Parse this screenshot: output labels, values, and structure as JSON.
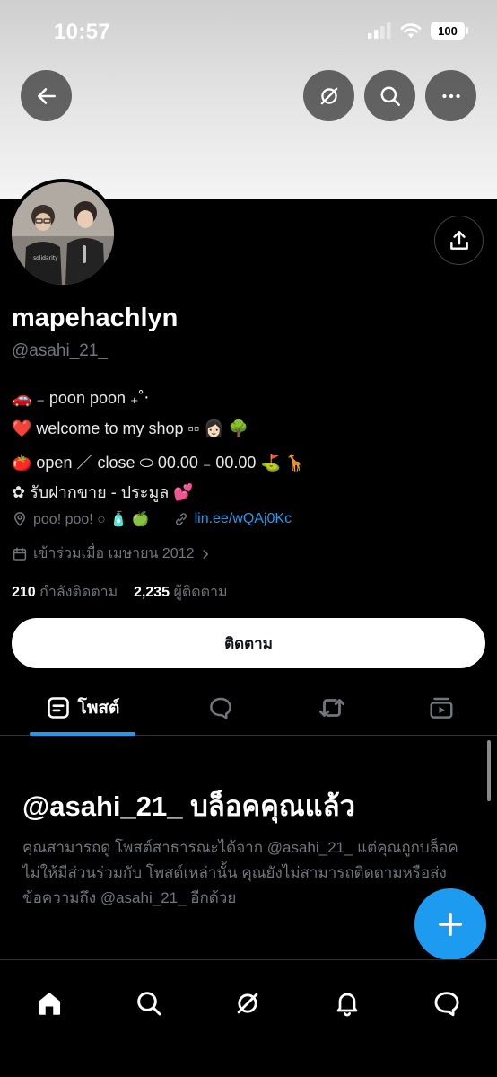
{
  "status_bar": {
    "time": "10:57",
    "battery": "100"
  },
  "profile": {
    "display_name": "mapehachlyn",
    "handle": "@asahi_21_",
    "bio": [
      "🚗 ₋ poon poon ₊˚‧",
      "❤️ welcome to my shop ▫▫ 👩🏻 🌳",
      "🍅 open ／ close ⬭ 00.00 ₋ 00.00 ⛳ 🦒",
      "✿ รับฝากขาย - ประมูล 💕"
    ],
    "location": "poo! poo! ○ 🧴 🍏",
    "link": "lin.ee/wQAj0Kc",
    "joined": "เข้าร่วมเมื่อ เมษายน 2012",
    "following_count": "210",
    "following_label": "กำลังติดตาม",
    "followers_count": "2,235",
    "followers_label": "ผู้ติดตาม"
  },
  "follow_button": "ติดตาม",
  "tabs": {
    "posts_label": "โพสต์"
  },
  "blocked": {
    "title": "@asahi_21_ บล็อคคุณแล้ว",
    "description": "คุณสามารถดู โพสต์สาธารณะได้จาก @asahi_21_ แต่คุณถูกบล็อคไม่ให้มีส่วนร่วมกับ โพสต์เหล่านั้น คุณยังไม่สามารถติดตามหรือส่งข้อความถึง @asahi_21_ อีกด้วย"
  },
  "colors": {
    "accent": "#1d9bf0",
    "background": "#000000",
    "muted_text": "#71767b"
  },
  "icons": [
    "back-arrow-icon",
    "grok-slash-icon",
    "search-icon",
    "more-icon",
    "share-icon",
    "location-icon",
    "link-icon",
    "calendar-icon",
    "posts-icon",
    "reply-icon",
    "repost-icon",
    "media-icon",
    "plus-icon",
    "home-icon",
    "notifications-icon",
    "messages-icon"
  ]
}
